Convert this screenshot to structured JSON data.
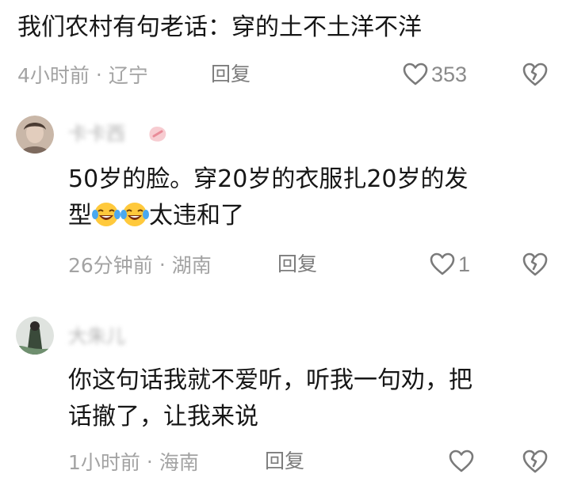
{
  "comments": [
    {
      "text": "我们农村有句老话：穿的土不土洋不洋",
      "time": "4小时前",
      "location": "辽宁",
      "reply_label": "回复",
      "likes": "353"
    },
    {
      "username": "卡卡西",
      "text_line1": "50岁的脸。穿20岁的衣服扎20岁的发",
      "text_line2_prefix": "型",
      "text_line2_suffix": "太违和了",
      "emoji_icon": "laughing-crying-emoji",
      "time": "26分钟前",
      "location": "湖南",
      "reply_label": "回复",
      "likes": "1"
    },
    {
      "username": "大朱儿",
      "text_line1": "你这句话我就不爱听，听我一句劝，把",
      "text_line2": "话撤了，让我来说",
      "time": "1小时前",
      "location": "海南",
      "reply_label": "回复",
      "likes": ""
    }
  ],
  "separator": "·",
  "icons": {
    "like": "heart-outline-icon",
    "dislike": "broken-heart-icon"
  },
  "colors": {
    "text": "#161616",
    "meta": "#a3a3a3",
    "reply": "#7c7c7c",
    "icon": "#7a7a7a"
  }
}
